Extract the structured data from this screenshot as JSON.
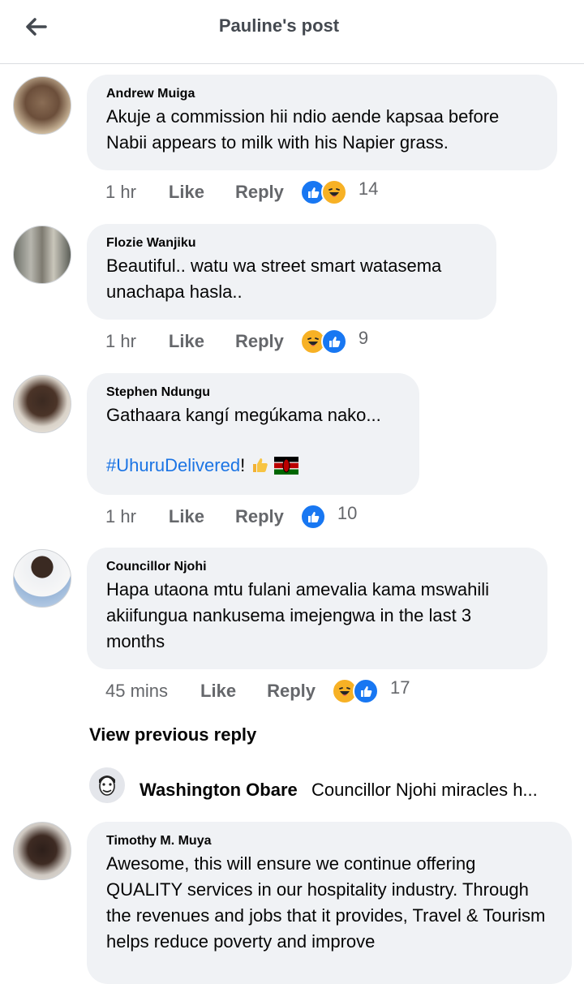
{
  "header": {
    "title": "Pauline's post",
    "back_icon": "arrow-left-icon"
  },
  "comments": [
    {
      "name": "Andrew Muiga",
      "text": "Akuje a commission hii ndio aende kapsaa before Nabii appears to milk with his Napier grass.",
      "time": "1 hr",
      "like": "Like",
      "reply": "Reply",
      "reactions": [
        "like-reaction-icon",
        "haha-reaction-icon"
      ],
      "count": "14"
    },
    {
      "name": "Flozie Wanjiku",
      "text": "Beautiful.. watu wa street smart watasema unachapa hasla..",
      "time": "1 hr",
      "like": "Like",
      "reply": "Reply",
      "reactions": [
        "haha-reaction-icon",
        "like-reaction-icon"
      ],
      "count": "9"
    },
    {
      "name": "Stephen Ndungu",
      "text": "Gathaara kangí megúkama nako...",
      "hashtag": "#UhuruDelivered",
      "hashtag_suffix": "!",
      "emojis": [
        "thumbs-up-emoji-icon",
        "kenya-flag-icon"
      ],
      "time": "1 hr",
      "like": "Like",
      "reply": "Reply",
      "reactions": [
        "like-reaction-icon"
      ],
      "count": "10"
    },
    {
      "name": "Councillor Njohi",
      "text": "Hapa utaona mtu fulani amevalia kama mswahili akiifungua nankusema imejengwa in the last 3 months",
      "time": "45 mins",
      "like": "Like",
      "reply": "Reply",
      "reactions": [
        "haha-reaction-icon",
        "like-reaction-icon"
      ],
      "count": "17"
    },
    {
      "name": "Timothy M. Muya",
      "text": "Awesome, this will ensure we continue offering QUALITY services in our hospitality industry. Through the revenues and jobs that it provides, Travel & Tourism helps reduce poverty and improve"
    }
  ],
  "view_previous": "View previous reply",
  "reply_preview": {
    "name": "Washington Obare",
    "text": "Councillor Njohi miracles h..."
  },
  "colors": {
    "bubble": "#f0f2f5",
    "meta": "#65676b",
    "link": "#1b74e4",
    "like_blue": "#1877f2",
    "haha_yellow": "#f7b125"
  }
}
